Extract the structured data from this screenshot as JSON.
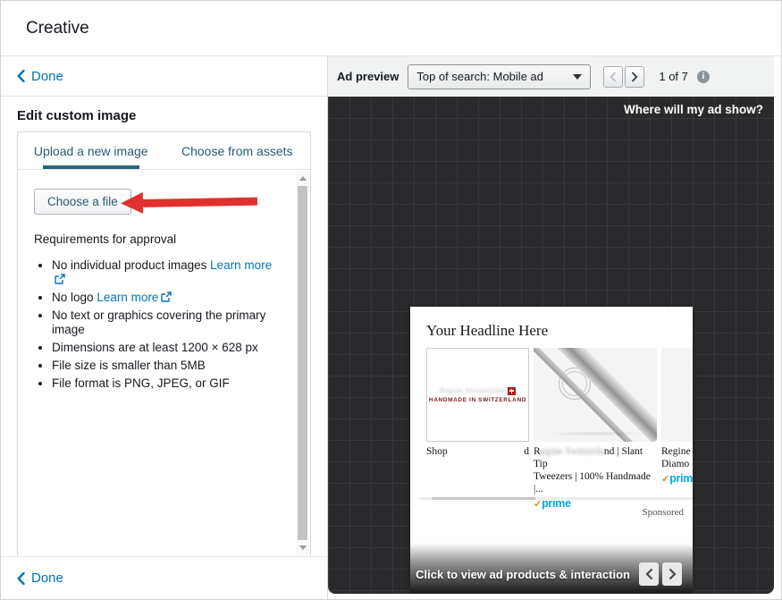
{
  "header": {
    "title": "Creative"
  },
  "left_panel": {
    "done_top_label": "Done",
    "done_bottom_label": "Done",
    "section_title": "Edit custom image",
    "tabs": {
      "upload_label": "Upload a new image",
      "assets_label": "Choose from assets"
    },
    "choose_file_label": "Choose a file",
    "requirements_heading": "Requirements for approval",
    "requirements": [
      {
        "text": "No individual product images",
        "link": "Learn more"
      },
      {
        "text": "No logo",
        "link": "Learn more"
      },
      {
        "text": "No text or graphics covering the primary image"
      },
      {
        "text": "Dimensions are at least 1200 × 628 px"
      },
      {
        "text": "File size is smaller than 5MB"
      },
      {
        "text": "File format is PNG, JPEG, or GIF"
      }
    ]
  },
  "preview": {
    "header_label": "Ad preview",
    "placement_dropdown_value": "Top of search: Mobile ad",
    "page_indicator": "1 of 7",
    "canvas_hint": "Where will my ad show?",
    "mockup": {
      "headline": "Your Headline Here",
      "brand_tile": {
        "blurred_name": "Regine Switzerland",
        "tagline": "Handmade in Switzerland",
        "caption_left": "Shop",
        "caption_right": "d"
      },
      "product2": {
        "title_start": "R",
        "title_blur": "egine Switzerla",
        "title_end": "nd | Slant Tip",
        "title_line2": "Tweezers | 100% Handmade |...",
        "prime_label": "prime"
      },
      "product3": {
        "title_line1": "Regine",
        "title_line2": "Diamo",
        "prime_label": "prime"
      },
      "sponsored_label": "Sponsored",
      "footer_label": "Click to view ad products & interaction"
    }
  },
  "colors": {
    "link_blue": "#0073bb",
    "tab_accent": "#2e647f",
    "annotation_red": "#e0312e",
    "prime_blue": "#00a8e1",
    "prime_check_orange": "#e88b0e",
    "canvas_background": "#2a2a2c"
  }
}
